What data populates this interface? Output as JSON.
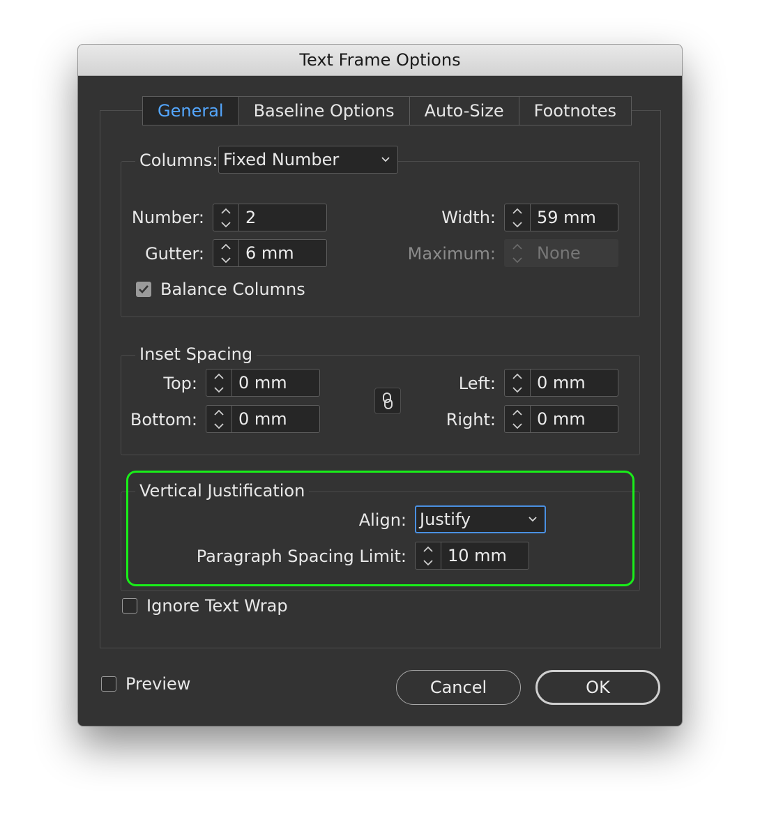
{
  "window": {
    "title": "Text Frame Options"
  },
  "tabs": [
    {
      "label": "General",
      "active": true
    },
    {
      "label": "Baseline Options",
      "active": false
    },
    {
      "label": "Auto-Size",
      "active": false
    },
    {
      "label": "Footnotes",
      "active": false
    }
  ],
  "columns": {
    "label": "Columns:",
    "mode": "Fixed Number",
    "number_label": "Number:",
    "number_value": "2",
    "gutter_label": "Gutter:",
    "gutter_value": "6 mm",
    "width_label": "Width:",
    "width_value": "59 mm",
    "maximum_label": "Maximum:",
    "maximum_value": "None",
    "balance_label": "Balance Columns",
    "balance_checked": true
  },
  "inset": {
    "legend": "Inset Spacing",
    "top_label": "Top:",
    "top_value": "0 mm",
    "bottom_label": "Bottom:",
    "bottom_value": "0 mm",
    "left_label": "Left:",
    "left_value": "0 mm",
    "right_label": "Right:",
    "right_value": "0 mm"
  },
  "vertical": {
    "legend": "Vertical Justification",
    "align_label": "Align:",
    "align_value": "Justify",
    "psl_label": "Paragraph Spacing Limit:",
    "psl_value": "10 mm"
  },
  "ignore_wrap": {
    "label": "Ignore Text Wrap",
    "checked": false
  },
  "preview": {
    "label": "Preview",
    "checked": false
  },
  "buttons": {
    "cancel": "Cancel",
    "ok": "OK"
  },
  "colors": {
    "dialog_bg": "#333333",
    "active_tab": "#54a7ff",
    "focus_ring": "#4a90e2",
    "highlight": "#19ee19"
  }
}
